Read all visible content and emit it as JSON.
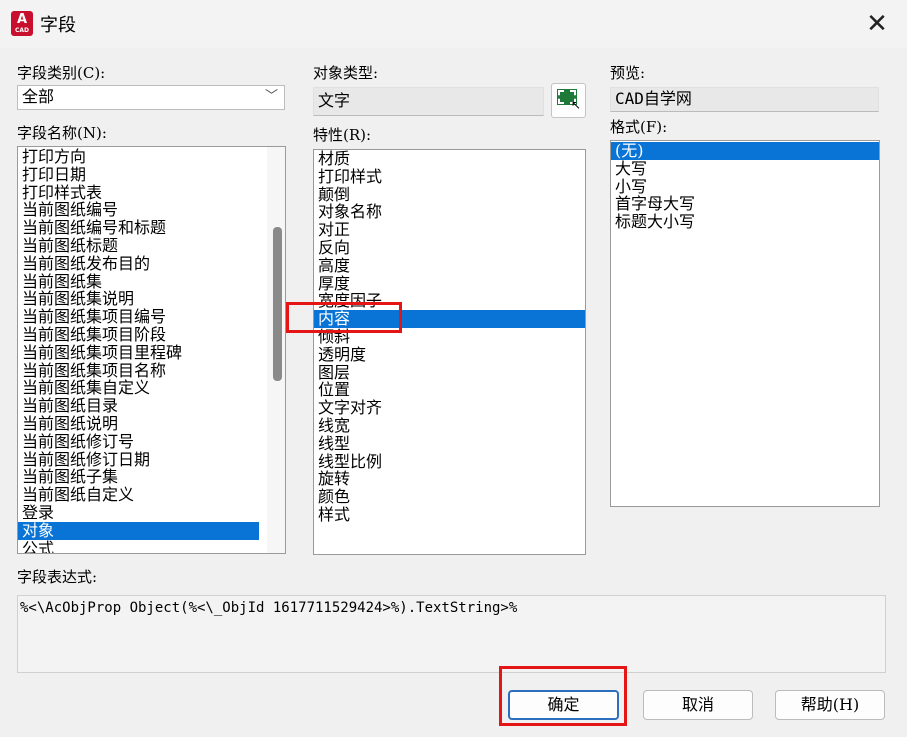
{
  "window": {
    "title": "字段",
    "app_icon_letter": "A",
    "app_icon_label": "CAD",
    "close_glyph": "✕"
  },
  "field_category": {
    "label": "字段类别(C):",
    "value": "全部"
  },
  "field_names": {
    "label": "字段名称(N):",
    "items": [
      "打印方向",
      "打印日期",
      "打印样式表",
      "当前图纸编号",
      "当前图纸编号和标题",
      "当前图纸标题",
      "当前图纸发布目的",
      "当前图纸集",
      "当前图纸集说明",
      "当前图纸集项目编号",
      "当前图纸集项目阶段",
      "当前图纸集项目里程碑",
      "当前图纸集项目名称",
      "当前图纸集自定义",
      "当前图纸目录",
      "当前图纸说明",
      "当前图纸修订号",
      "当前图纸修订日期",
      "当前图纸子集",
      "当前图纸自定义",
      "登录",
      "对象",
      "公式"
    ],
    "selected": "对象"
  },
  "object_type": {
    "label": "对象类型:",
    "value": "文字"
  },
  "properties": {
    "label": "特性(R):",
    "items": [
      "材质",
      "打印样式",
      "颠倒",
      "对象名称",
      "对正",
      "反向",
      "高度",
      "厚度",
      "宽度因子",
      "内容",
      "倾斜",
      "透明度",
      "图层",
      "位置",
      "文字对齐",
      "线宽",
      "线型",
      "线型比例",
      "旋转",
      "颜色",
      "样式"
    ],
    "selected": "内容"
  },
  "preview": {
    "label": "预览:",
    "value": "CAD自学网"
  },
  "format": {
    "label": "格式(F):",
    "items": [
      "(无)",
      "大写",
      "小写",
      "首字母大写",
      "标题大小写"
    ],
    "selected": "(无)"
  },
  "expression": {
    "label": "字段表达式:",
    "value": "%<\\AcObjProp Object(%<\\_ObjId 1617711529424>%).TextString>%"
  },
  "buttons": {
    "ok": "确定",
    "cancel": "取消",
    "help": "帮助(H)"
  },
  "colors": {
    "selection": "#0a74d6",
    "highlight_box": "#e51515"
  }
}
